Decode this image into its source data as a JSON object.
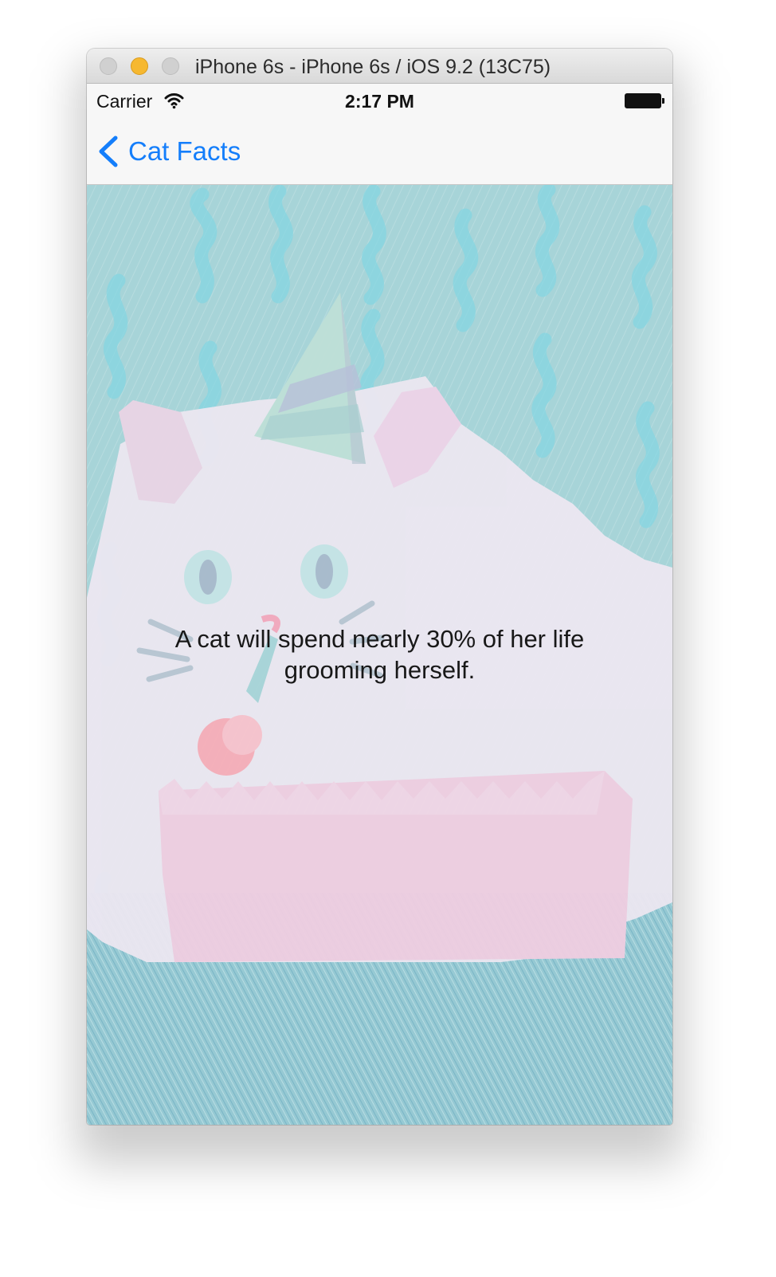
{
  "window": {
    "title": "iPhone 6s - iPhone 6s / iOS 9.2 (13C75)",
    "controls": [
      "close",
      "minimize",
      "zoom"
    ],
    "colors": {
      "close": "#d0d0d0",
      "minimize": "#f6b830",
      "zoom": "#d0d0d0"
    }
  },
  "status_bar": {
    "carrier": "Carrier",
    "signal_icon": "wifi-icon",
    "time": "2:17 PM",
    "battery_icon": "battery-icon"
  },
  "navigation": {
    "back_icon": "chevron-left-icon",
    "back_label": "Cat Facts",
    "accent": "#147efb"
  },
  "fact": {
    "text": "A cat will spend nearly 30% of her life grooming herself."
  },
  "background_art": {
    "subject": "party-cat-illustration"
  }
}
